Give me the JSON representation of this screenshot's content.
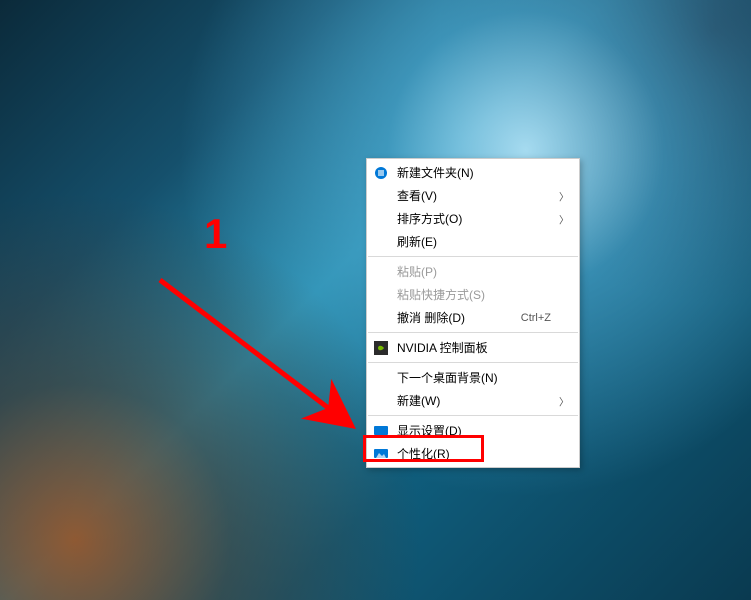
{
  "annotation": {
    "number": "1"
  },
  "context_menu": {
    "items": [
      {
        "label": "新建文件夹(N)",
        "icon": "monitor-icon",
        "icon_color": "#0078d7"
      },
      {
        "label": "查看(V)",
        "submenu": true
      },
      {
        "label": "排序方式(O)",
        "submenu": true
      },
      {
        "label": "刷新(E)"
      },
      {
        "sep": true
      },
      {
        "label": "粘贴(P)",
        "disabled": true
      },
      {
        "label": "粘贴快捷方式(S)",
        "disabled": true
      },
      {
        "label": "撤消 删除(D)",
        "shortcut": "Ctrl+Z"
      },
      {
        "sep": true
      },
      {
        "label": "NVIDIA 控制面板",
        "icon": "nvidia-icon",
        "icon_color": "#2b2b2b"
      },
      {
        "sep": true
      },
      {
        "label": "下一个桌面背景(N)"
      },
      {
        "label": "新建(W)",
        "submenu": true
      },
      {
        "sep": true
      },
      {
        "label": "显示设置(D)",
        "icon": "display-icon",
        "icon_color": "#0078d7"
      },
      {
        "label": "个性化(R)",
        "icon": "personalize-icon",
        "icon_color": "#0078d7"
      }
    ]
  }
}
